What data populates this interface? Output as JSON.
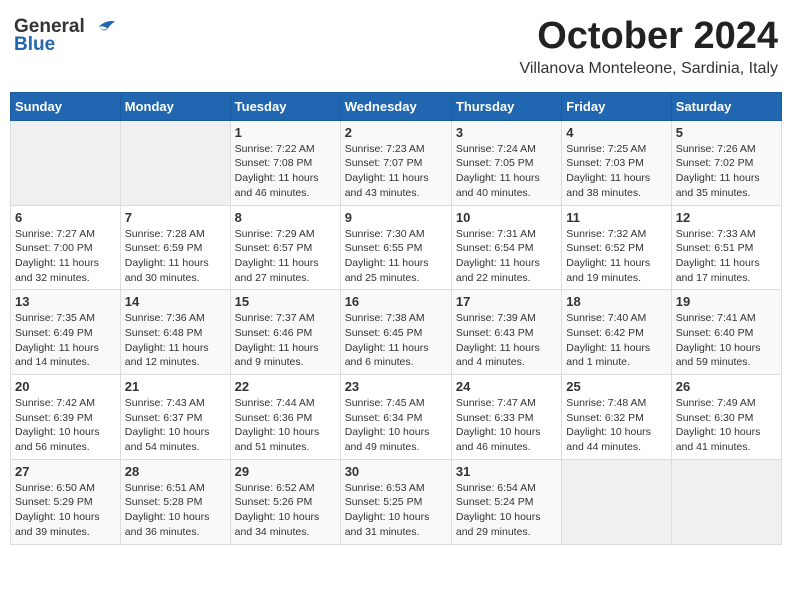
{
  "header": {
    "logo_general": "General",
    "logo_blue": "Blue",
    "month": "October 2024",
    "location": "Villanova Monteleone, Sardinia, Italy"
  },
  "columns": [
    "Sunday",
    "Monday",
    "Tuesday",
    "Wednesday",
    "Thursday",
    "Friday",
    "Saturday"
  ],
  "weeks": [
    [
      {
        "day": "",
        "sunrise": "",
        "sunset": "",
        "daylight": ""
      },
      {
        "day": "",
        "sunrise": "",
        "sunset": "",
        "daylight": ""
      },
      {
        "day": "1",
        "sunrise": "Sunrise: 7:22 AM",
        "sunset": "Sunset: 7:08 PM",
        "daylight": "Daylight: 11 hours and 46 minutes."
      },
      {
        "day": "2",
        "sunrise": "Sunrise: 7:23 AM",
        "sunset": "Sunset: 7:07 PM",
        "daylight": "Daylight: 11 hours and 43 minutes."
      },
      {
        "day": "3",
        "sunrise": "Sunrise: 7:24 AM",
        "sunset": "Sunset: 7:05 PM",
        "daylight": "Daylight: 11 hours and 40 minutes."
      },
      {
        "day": "4",
        "sunrise": "Sunrise: 7:25 AM",
        "sunset": "Sunset: 7:03 PM",
        "daylight": "Daylight: 11 hours and 38 minutes."
      },
      {
        "day": "5",
        "sunrise": "Sunrise: 7:26 AM",
        "sunset": "Sunset: 7:02 PM",
        "daylight": "Daylight: 11 hours and 35 minutes."
      }
    ],
    [
      {
        "day": "6",
        "sunrise": "Sunrise: 7:27 AM",
        "sunset": "Sunset: 7:00 PM",
        "daylight": "Daylight: 11 hours and 32 minutes."
      },
      {
        "day": "7",
        "sunrise": "Sunrise: 7:28 AM",
        "sunset": "Sunset: 6:59 PM",
        "daylight": "Daylight: 11 hours and 30 minutes."
      },
      {
        "day": "8",
        "sunrise": "Sunrise: 7:29 AM",
        "sunset": "Sunset: 6:57 PM",
        "daylight": "Daylight: 11 hours and 27 minutes."
      },
      {
        "day": "9",
        "sunrise": "Sunrise: 7:30 AM",
        "sunset": "Sunset: 6:55 PM",
        "daylight": "Daylight: 11 hours and 25 minutes."
      },
      {
        "day": "10",
        "sunrise": "Sunrise: 7:31 AM",
        "sunset": "Sunset: 6:54 PM",
        "daylight": "Daylight: 11 hours and 22 minutes."
      },
      {
        "day": "11",
        "sunrise": "Sunrise: 7:32 AM",
        "sunset": "Sunset: 6:52 PM",
        "daylight": "Daylight: 11 hours and 19 minutes."
      },
      {
        "day": "12",
        "sunrise": "Sunrise: 7:33 AM",
        "sunset": "Sunset: 6:51 PM",
        "daylight": "Daylight: 11 hours and 17 minutes."
      }
    ],
    [
      {
        "day": "13",
        "sunrise": "Sunrise: 7:35 AM",
        "sunset": "Sunset: 6:49 PM",
        "daylight": "Daylight: 11 hours and 14 minutes."
      },
      {
        "day": "14",
        "sunrise": "Sunrise: 7:36 AM",
        "sunset": "Sunset: 6:48 PM",
        "daylight": "Daylight: 11 hours and 12 minutes."
      },
      {
        "day": "15",
        "sunrise": "Sunrise: 7:37 AM",
        "sunset": "Sunset: 6:46 PM",
        "daylight": "Daylight: 11 hours and 9 minutes."
      },
      {
        "day": "16",
        "sunrise": "Sunrise: 7:38 AM",
        "sunset": "Sunset: 6:45 PM",
        "daylight": "Daylight: 11 hours and 6 minutes."
      },
      {
        "day": "17",
        "sunrise": "Sunrise: 7:39 AM",
        "sunset": "Sunset: 6:43 PM",
        "daylight": "Daylight: 11 hours and 4 minutes."
      },
      {
        "day": "18",
        "sunrise": "Sunrise: 7:40 AM",
        "sunset": "Sunset: 6:42 PM",
        "daylight": "Daylight: 11 hours and 1 minute."
      },
      {
        "day": "19",
        "sunrise": "Sunrise: 7:41 AM",
        "sunset": "Sunset: 6:40 PM",
        "daylight": "Daylight: 10 hours and 59 minutes."
      }
    ],
    [
      {
        "day": "20",
        "sunrise": "Sunrise: 7:42 AM",
        "sunset": "Sunset: 6:39 PM",
        "daylight": "Daylight: 10 hours and 56 minutes."
      },
      {
        "day": "21",
        "sunrise": "Sunrise: 7:43 AM",
        "sunset": "Sunset: 6:37 PM",
        "daylight": "Daylight: 10 hours and 54 minutes."
      },
      {
        "day": "22",
        "sunrise": "Sunrise: 7:44 AM",
        "sunset": "Sunset: 6:36 PM",
        "daylight": "Daylight: 10 hours and 51 minutes."
      },
      {
        "day": "23",
        "sunrise": "Sunrise: 7:45 AM",
        "sunset": "Sunset: 6:34 PM",
        "daylight": "Daylight: 10 hours and 49 minutes."
      },
      {
        "day": "24",
        "sunrise": "Sunrise: 7:47 AM",
        "sunset": "Sunset: 6:33 PM",
        "daylight": "Daylight: 10 hours and 46 minutes."
      },
      {
        "day": "25",
        "sunrise": "Sunrise: 7:48 AM",
        "sunset": "Sunset: 6:32 PM",
        "daylight": "Daylight: 10 hours and 44 minutes."
      },
      {
        "day": "26",
        "sunrise": "Sunrise: 7:49 AM",
        "sunset": "Sunset: 6:30 PM",
        "daylight": "Daylight: 10 hours and 41 minutes."
      }
    ],
    [
      {
        "day": "27",
        "sunrise": "Sunrise: 6:50 AM",
        "sunset": "Sunset: 5:29 PM",
        "daylight": "Daylight: 10 hours and 39 minutes."
      },
      {
        "day": "28",
        "sunrise": "Sunrise: 6:51 AM",
        "sunset": "Sunset: 5:28 PM",
        "daylight": "Daylight: 10 hours and 36 minutes."
      },
      {
        "day": "29",
        "sunrise": "Sunrise: 6:52 AM",
        "sunset": "Sunset: 5:26 PM",
        "daylight": "Daylight: 10 hours and 34 minutes."
      },
      {
        "day": "30",
        "sunrise": "Sunrise: 6:53 AM",
        "sunset": "Sunset: 5:25 PM",
        "daylight": "Daylight: 10 hours and 31 minutes."
      },
      {
        "day": "31",
        "sunrise": "Sunrise: 6:54 AM",
        "sunset": "Sunset: 5:24 PM",
        "daylight": "Daylight: 10 hours and 29 minutes."
      },
      {
        "day": "",
        "sunrise": "",
        "sunset": "",
        "daylight": ""
      },
      {
        "day": "",
        "sunrise": "",
        "sunset": "",
        "daylight": ""
      }
    ]
  ]
}
